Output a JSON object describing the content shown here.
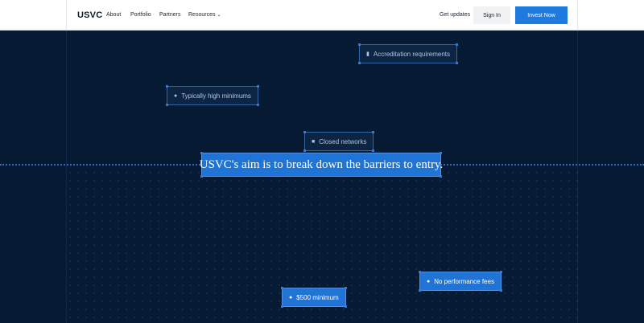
{
  "nav": {
    "logo": "USVC",
    "links": [
      "About",
      "Portfolio",
      "Partners",
      "Resources"
    ],
    "get_updates": "Get updates",
    "sign_in": "Sign In",
    "invest_now": "Invest Now"
  },
  "hero": {
    "headline": "USVC's aim is to break down the barriers to entry.",
    "chips": {
      "accreditation": "Accreditation requirements",
      "minimums": "Typically high minimums",
      "closed": "Closed networks",
      "no_fees": "No performance fees",
      "min500": "$500 minimum"
    }
  },
  "icons": [
    "document-icon",
    "money-bag-icon",
    "lock-icon",
    "dollar-icon",
    "chevron-down-icon"
  ],
  "colors": {
    "background": "#071a33",
    "accent": "#1f74d6",
    "invest_button": "#1f7ae0"
  }
}
